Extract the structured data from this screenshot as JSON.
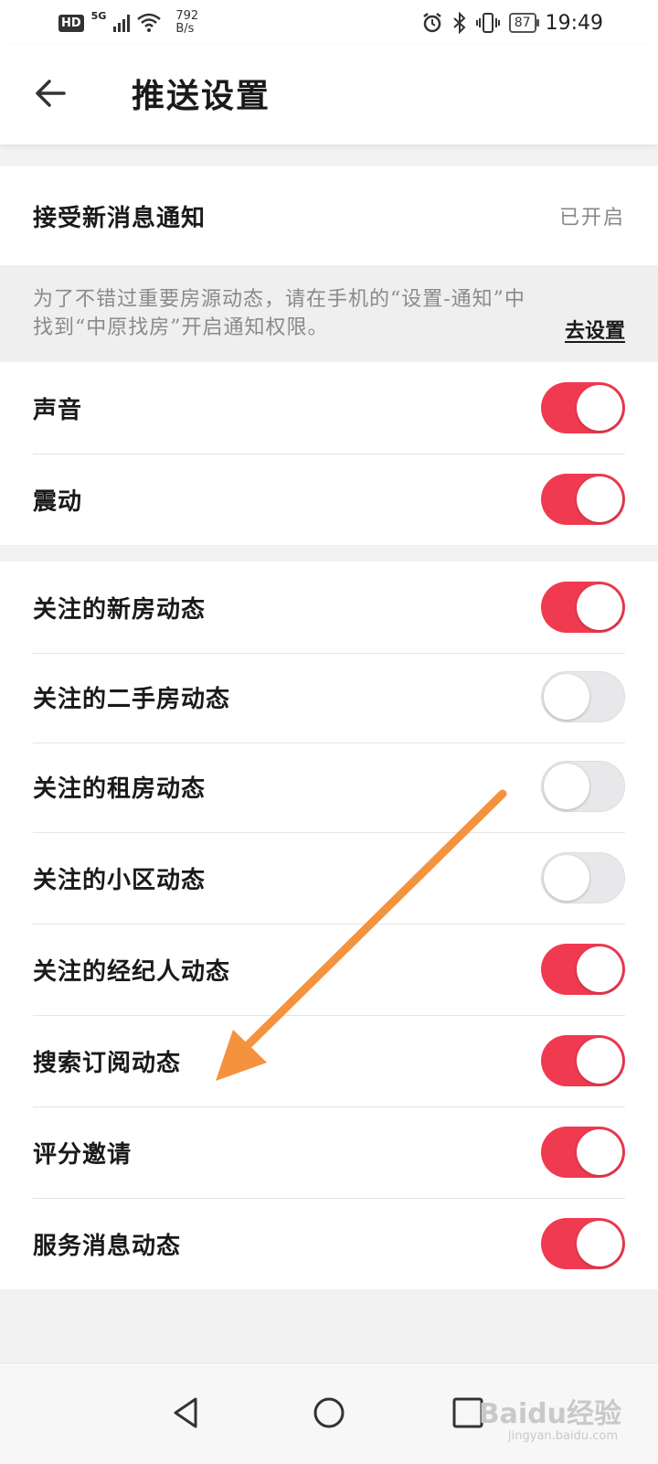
{
  "status_bar": {
    "hd": "HD",
    "network": "5G",
    "speed_value": "792",
    "speed_unit": "B/s",
    "battery": "87",
    "time": "19:49"
  },
  "header": {
    "title": "推送设置"
  },
  "notifications": {
    "label": "接受新消息通知",
    "value": "已开启"
  },
  "notice": {
    "text": "为了不错过重要房源动态，请在手机的“设置-通知”中找到“中原找房”开启通知权限。",
    "link": "去设置"
  },
  "alerts": [
    {
      "label": "声音",
      "on": true
    },
    {
      "label": "震动",
      "on": true
    }
  ],
  "subscriptions": [
    {
      "label": "关注的新房动态",
      "on": true
    },
    {
      "label": "关注的二手房动态",
      "on": false
    },
    {
      "label": "关注的租房动态",
      "on": false
    },
    {
      "label": "关注的小区动态",
      "on": false
    },
    {
      "label": "关注的经纪人动态",
      "on": true
    },
    {
      "label": "搜索订阅动态",
      "on": true
    },
    {
      "label": "评分邀请",
      "on": true
    },
    {
      "label": "服务消息动态",
      "on": true
    }
  ],
  "watermark": {
    "logo": "Baidu经验",
    "url": "jingyan.baidu.com"
  },
  "colors": {
    "toggle_on": "#f03a50",
    "toggle_off": "#e8e8ea",
    "arrow": "#f5923e"
  }
}
